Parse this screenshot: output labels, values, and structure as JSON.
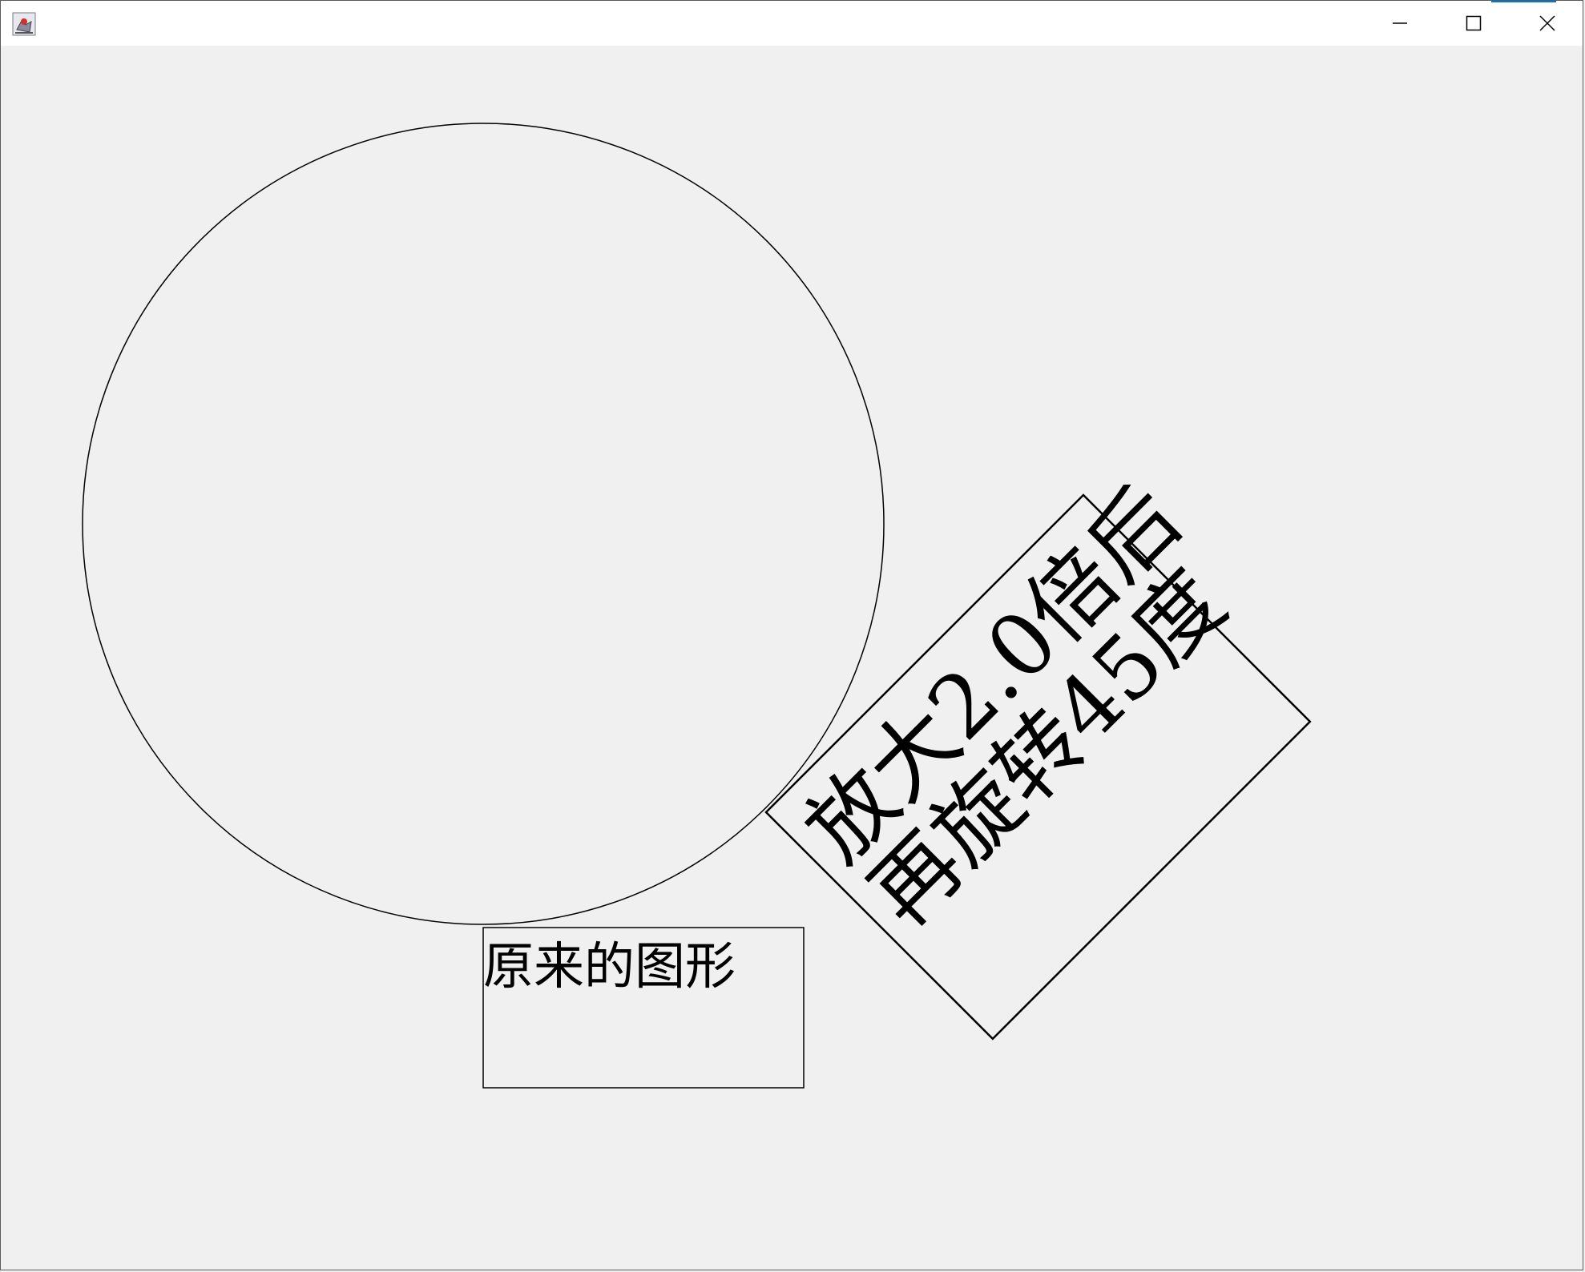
{
  "window": {
    "title": "",
    "controls": {
      "minimize_icon": "minimize-icon",
      "maximize_icon": "maximize-icon",
      "close_icon": "close-icon"
    }
  },
  "canvas": {
    "original_label": "原来的图形",
    "transformed_label_line1": "放大2.0倍后",
    "transformed_label_line2": "再旋转45度"
  }
}
